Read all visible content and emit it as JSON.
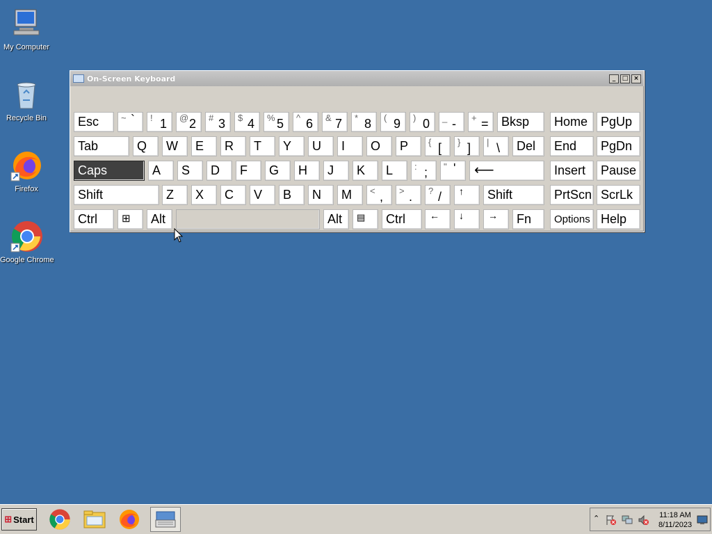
{
  "desktop": {
    "icons": [
      {
        "label": "My Computer",
        "icon": "my-computer-icon"
      },
      {
        "label": "Recycle Bin",
        "icon": "recycle-bin-icon"
      },
      {
        "label": "Firefox",
        "icon": "firefox-icon"
      },
      {
        "label": "Google Chrome",
        "icon": "chrome-icon"
      }
    ],
    "background": "#3a6ea5"
  },
  "osk": {
    "title": "On-Screen Keyboard",
    "controls": {
      "minimize": "_",
      "maximize": "□",
      "close": "×"
    },
    "keys": {
      "esc": "Esc",
      "tilde_shift": "~",
      "tilde_base": "`",
      "k1s": "!",
      "k1": "1",
      "k2s": "@",
      "k2": "2",
      "k3s": "#",
      "k3": "3",
      "k4s": "$",
      "k4": "4",
      "k5s": "%",
      "k5": "5",
      "k6s": "^",
      "k6": "6",
      "k7s": "&",
      "k7": "7",
      "k8s": "*",
      "k8": "8",
      "k9s": "(",
      "k9": "9",
      "k0s": ")",
      "k0": "0",
      "minus_s": "_",
      "minus": "-",
      "eq_s": "+",
      "eq": "=",
      "bksp": "Bksp",
      "home": "Home",
      "pgup": "PgUp",
      "tab": "Tab",
      "q": "Q",
      "w": "W",
      "e": "E",
      "r": "R",
      "t": "T",
      "y": "Y",
      "u": "U",
      "i": "I",
      "o": "O",
      "p": "P",
      "lbr_s": "{",
      "lbr": "[",
      "rbr_s": "}",
      "rbr": "]",
      "bsl_s": "|",
      "bsl": "\\",
      "del": "Del",
      "end": "End",
      "pgdn": "PgDn",
      "caps": "Caps",
      "a": "A",
      "s": "S",
      "d": "D",
      "f": "F",
      "g": "G",
      "h": "H",
      "j": "J",
      "k": "K",
      "l": "L",
      "semi_s": ":",
      "semi": ";",
      "quote_s": "\"",
      "quote": "'",
      "enter": "⟵",
      "insert": "Insert",
      "pause": "Pause",
      "shift": "Shift",
      "z": "Z",
      "x": "X",
      "c": "C",
      "v": "V",
      "b": "B",
      "n": "N",
      "m": "M",
      "comma_s": "<",
      "comma": ",",
      "period_s": ">",
      "period": ".",
      "slash_s": "?",
      "slash": "/",
      "up": "↑",
      "rshift": "Shift",
      "prtscn": "PrtScn",
      "scrlk": "ScrLk",
      "ctrl": "Ctrl",
      "win": "⊞",
      "alt": "Alt",
      "ralt": "Alt",
      "menu": "▤",
      "rctrl": "Ctrl",
      "left": "←",
      "down": "↓",
      "right": "→",
      "fn": "Fn",
      "options": "Options",
      "help": "Help"
    },
    "active_key": "Caps"
  },
  "taskbar": {
    "start_label": "Start",
    "apps": [
      "chrome-icon",
      "file-explorer-icon",
      "firefox-icon",
      "on-screen-keyboard-icon"
    ],
    "clock": {
      "time": "11:18 AM",
      "date": "8/11/2023"
    }
  }
}
